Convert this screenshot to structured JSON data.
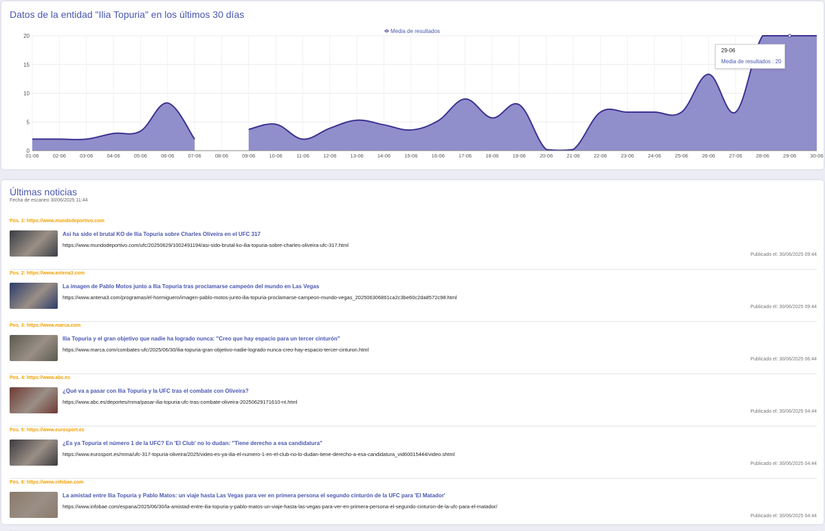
{
  "chart_card": {
    "title": "Datos de la entidad \"Ilia Topuria\" en los últimos 30 días"
  },
  "chart_data": {
    "type": "area",
    "legend": "Media de resultados",
    "legend_position": "top-center",
    "series_color": "#8b88c9",
    "line_color": "#3b3290",
    "categories": [
      "01-06",
      "02-06",
      "03-06",
      "04-06",
      "05-06",
      "06-06",
      "07-06",
      "08-06",
      "09-06",
      "10-06",
      "11-06",
      "12-06",
      "13-06",
      "14-06",
      "15-06",
      "16-06",
      "17-06",
      "18-06",
      "19-06",
      "20-06",
      "21-06",
      "22-06",
      "23-06",
      "24-06",
      "25-06",
      "26-06",
      "27-06",
      "28-06",
      "29-06",
      "30-06"
    ],
    "values": [
      2,
      2,
      2,
      3,
      3.4,
      8.3,
      2,
      null,
      3.7,
      4.6,
      2,
      3.9,
      5.3,
      4.5,
      3.6,
      5.2,
      9,
      5.7,
      8,
      0.2,
      0.2,
      6.7,
      6.7,
      6.7,
      6.7,
      13.3,
      6.7,
      20,
      20,
      20
    ],
    "ylim": [
      0,
      20
    ],
    "yticks": [
      0,
      5,
      10,
      15,
      20
    ],
    "grid": true,
    "tooltip": {
      "date": "29-06",
      "label": "Media de resultados : 20"
    }
  },
  "news_card": {
    "title": "Últimas noticias",
    "scan_date": "Fecha de escaneo 30/06/2025 11:44",
    "items": [
      {
        "pos": "Pos. 1: https://www.mundodeportivo.com",
        "title": "Así ha sido el brutal KO de Ilia Topuria sobre Charles Oliveira en el UFC 317",
        "url": "https://www.mundodeportivo.com/ufc/20250629/1002491194/asi-sido-brutal-ko-ilia-topuria-sobre-charles-oliveira-ufc-317.html",
        "date": "Publicado el: 30/06/2025 09:44",
        "thumb": "#3a3d44"
      },
      {
        "pos": "Pos. 2: https://www.antena3.com",
        "title": "La imagen de Pablo Motos junto a Ilia Topuria tras proclamarse campeón del mundo en Las Vegas",
        "url": "https://www.antena3.com/programas/el-hormiguero/imagen-pablo-motos-junto-ilia-topuria-proclamarse-campeon-mundo-vegas_2025063068​61ca2c3be60c2da8572c98.html",
        "date": "Publicado el: 30/06/2025 09:44",
        "thumb": "#2b3b6a"
      },
      {
        "pos": "Pos. 3: https://www.marca.com",
        "title": "Ilia Topuria y el gran objetivo que nadie ha logrado nunca: \"Creo que hay espacio para un tercer cinturón\"",
        "url": "https://www.marca.com/combates-ufc/2025/06/30/ilia-topuria-gran-objetivo-nadie-logrado-nunca-creo-hay-espacio-tercer-cinturon.html",
        "date": "Publicado el: 30/06/2025 06:44",
        "thumb": "#5b5a4e"
      },
      {
        "pos": "Pos. 4: https://www.abc.es",
        "title": "¿Qué va a pasar con Ilia Topuria y la UFC tras el combate con Oliveira?",
        "url": "https://www.abc.es/deportes/mma/pasar-ilia-topuria-ufc-tras-combate-oliveira-20250629171610-nt.html",
        "date": "Publicado el: 30/06/2025 04:44",
        "thumb": "#6e3a33"
      },
      {
        "pos": "Pos. 5: https://www.eurosport.es",
        "title": "¿Es ya Topuria el número 1 de la UFC? En 'El Club' no lo dudan: \"Tiene derecho a esa candidatura\"",
        "url": "https://www.eurosport.es/mma/ufc-317-topuria-oliveira/2025/video-es-ya-ilia-el-numero-1-en-el-club-no-lo-dudan-tiene-derecho-a-esa-candidatura_vid60015444/video.shtml",
        "date": "Publicado el: 30/06/2025 04:44",
        "thumb": "#3d3a3f"
      },
      {
        "pos": "Pos. 6: https://www.infobae.com",
        "title": "La amistad entre Ilia Topuria y Pablo Matos: un viaje hasta Las Vegas para ver en primera persona el segundo cinturón de la UFC para 'El Matador'",
        "url": "https://www.infobae.com/espana/2025/06/30/la-amistad-entre-ilia-topuria-y-pablo-matos-un-viaje-hasta-las-vegas-para-ver-en-primera-persona-el-segundo-cinturon-de-la-ufc-para-el-matador/",
        "date": "Publicado el: 30/06/2025 04:44",
        "thumb": "#8a7a6a"
      }
    ]
  }
}
